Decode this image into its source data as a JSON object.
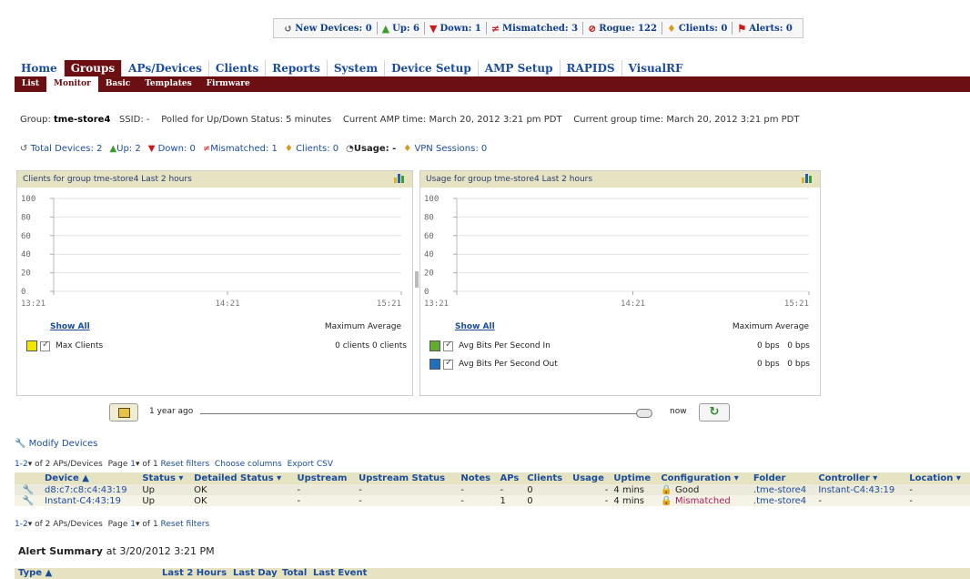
{
  "status_bar": {
    "items": [
      {
        "icon": "refresh-icon",
        "label": "New Devices: 0"
      },
      {
        "icon": "up-arrow-icon",
        "label": "Up: 6"
      },
      {
        "icon": "down-arrow-icon",
        "label": "Down: 1"
      },
      {
        "icon": "mismatch-icon",
        "label": "Mismatched: 3"
      },
      {
        "icon": "rogue-icon",
        "label": "Rogue: 122"
      },
      {
        "icon": "client-icon",
        "label": "Clients: 0"
      },
      {
        "icon": "alert-flag-icon",
        "label": "Alerts: 0"
      }
    ]
  },
  "nav": {
    "tabs": [
      "Home",
      "Groups",
      "APs/Devices",
      "Clients",
      "Reports",
      "System",
      "Device Setup",
      "AMP Setup",
      "RAPIDS",
      "VisualRF"
    ],
    "active_tab": "Groups",
    "subtabs": [
      "List",
      "Monitor",
      "Basic",
      "Templates",
      "Firmware"
    ],
    "active_subtab": "Monitor"
  },
  "info": {
    "group_label": "Group:",
    "group_name": "tme-store4",
    "ssid": "SSID: -",
    "polled": "Polled for Up/Down Status: 5 minutes",
    "amp_time": "Current AMP time: March 20, 2012 3:21 pm PDT",
    "group_time": "Current group time: March 20, 2012 3:21 pm PDT"
  },
  "summary": {
    "total": "Total Devices: 2",
    "up": "Up: 2",
    "down": "Down: 0",
    "mismatched": "Mismatched: 1",
    "clients": "Clients: 0",
    "usage": "Usage: -",
    "vpn": "VPN Sessions: 0"
  },
  "chart_data": [
    {
      "type": "line",
      "title": "Clients for group tme-store4   Last 2 hours",
      "x_ticks": [
        "13:21",
        "14:21",
        "15:21"
      ],
      "y_ticks": [
        0,
        20,
        40,
        60,
        80,
        100
      ],
      "ylim": [
        0,
        100
      ],
      "grid": true,
      "series": [
        {
          "name": "Max Clients",
          "color": "#f2e600",
          "values": [],
          "maximum": "0 clients",
          "average": "0 clients"
        }
      ],
      "show_all": "Show All",
      "legend_headers": "Maximum Average"
    },
    {
      "type": "line",
      "title": "Usage for group tme-store4   Last 2 hours",
      "x_ticks": [
        "13:21",
        "14:21",
        "15:21"
      ],
      "y_ticks": [
        0,
        20,
        40,
        60,
        80,
        100
      ],
      "ylim": [
        0,
        100
      ],
      "grid": true,
      "series": [
        {
          "name": "Avg Bits Per Second In",
          "color": "#5fae2e",
          "values": [],
          "maximum": "0 bps",
          "average": "0 bps"
        },
        {
          "name": "Avg Bits Per Second Out",
          "color": "#1e6fc2",
          "values": [],
          "maximum": "0 bps",
          "average": "0 bps"
        }
      ],
      "show_all": "Show All",
      "legend_headers": "Maximum Average"
    }
  ],
  "timeslider": {
    "start": "1 year ago",
    "end": "now"
  },
  "modify_devices": "Modify Devices",
  "pager_top": {
    "range": "1-2",
    "of": "of 2 APs/Devices",
    "page": "Page",
    "page_num": "1",
    "of_pages": "of 1",
    "links": [
      "Reset filters",
      "Choose columns",
      "Export CSV"
    ]
  },
  "pager_bottom": {
    "range": "1-2",
    "of": "of 2 APs/Devices",
    "page": "Page",
    "page_num": "1",
    "of_pages": "of 1",
    "links": [
      "Reset filters"
    ]
  },
  "device_table": {
    "columns": [
      "",
      "Device ▲",
      "Status ▾",
      "Detailed Status ▾",
      "Upstream",
      "Upstream Status",
      "Notes",
      "APs",
      "Clients",
      "Usage",
      "Uptime",
      "Configuration ▾",
      "Folder",
      "Controller ▾",
      "Location ▾"
    ],
    "rows": [
      [
        "d8:c7:c8:c4:43:19",
        "Up",
        "OK",
        "-",
        "-",
        "-",
        "-",
        "0",
        "-",
        "4 mins",
        "Good",
        ".tme-store4",
        "Instant-C4:43:19",
        "-"
      ],
      [
        "Instant-C4:43:19",
        "Up",
        "OK",
        "-",
        "-",
        "-",
        "1",
        "0",
        "-",
        "4 mins",
        "Mismatched",
        ".tme-store4",
        "-",
        "-"
      ]
    ]
  },
  "alerts": {
    "title": "Alert Summary",
    "at": "at 3/20/2012 3:21 PM",
    "columns": [
      "Type ▲",
      "Last 2 Hours",
      "Last Day",
      "Total",
      "Last Event"
    ]
  }
}
